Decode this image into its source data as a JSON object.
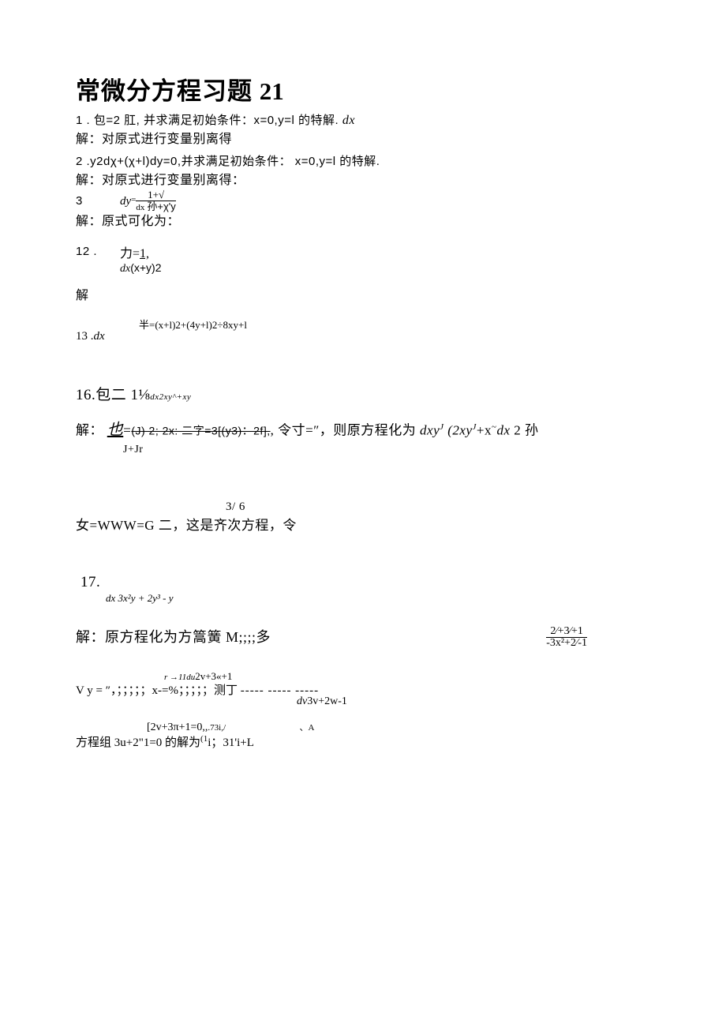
{
  "title_cn": "常微分方程习题",
  "title_num": "21",
  "p1": "1 . 包=2 肛, 并求满足初始条件：x=0,y=l 的特解. ",
  "p1_dx": "dx",
  "p1_sol": "解：对原式进行变量别离得",
  "p2": "2  .y2dχ+(χ+l)dy=0,并求满足初始条件： x=0,y=l 的特解.",
  "p2_sol": "解：对原式进行变量别离得：",
  "p3_num": "3",
  "p3_dy": "dy",
  "p3_eq": "=",
  "p3_top": "1+√",
  "p3_bot_dx": "dx",
  "p3_bot": "孙+χ'y",
  "p3_sol": "解：原式可化为：",
  "p12_num": "12  .",
  "p12_force": "力=",
  "p12_one": "1,",
  "p12_dx": "dx",
  "p12_bot": "(x+y)2",
  "p12_sol": "解",
  "p13_top": "半=(x+l)2+(4y+l)2÷8xy+l",
  "p13_num": "13  .",
  "p13_dx": "dx",
  "p16": "16.包二 1⅛",
  "p16_tail": "dx2xy^+xy",
  "p16_sol_a": "解：",
  "p16_ye": "也",
  "p16_eq": "=",
  "p16_strike": "(J) 2; 2x:   二字=3[(y3)：2f],",
  "p16_rest": ", 令寸=″，则原方程化为 ",
  "p16_dxy": "dxy",
  "p16_sup1": "J",
  "p16_p2": " (2xy",
  "p16_sup2": "J",
  "p16_plusx": "+x",
  "p16_tilde": "~",
  "p16_dx2": "dx",
  "p16_tail2": " 2 孙",
  "p16_jjr": "J+Jr",
  "p16_36": "3/      6",
  "p16_www": "女=WWW=G 二，这是齐次方程，令",
  "p17_num": "17.",
  "p17_bot": "dx  3x²y  +  2y³  -  y",
  "p17_sol": "解：原方程化为方篙簧 M;;;;多",
  "p17_frac_top": "2⁄+3⁄+1",
  "p17_frac_bot": "-3x²+2⁄-1",
  "p17_arrow": "r →11du",
  "p17_arrow_rest": "2v+3«+1",
  "p17_vy": "V y = ″，；；；；；x-=%；；；；；测丁 ",
  "p17_dashes": "----- ----- -----",
  "p17_dv": "dv",
  "p17_dv_rest": "3v+2w-1",
  "p17_braces": "[2v+3π+1=0,,",
  "p17_73i": ".73i,/",
  "p17_tiny": "、A",
  "p17_last": "方程组 3u+2\"1=0 的解为",
  "p17_sup": "(1",
  "p17_last2": "i；31'i+L"
}
